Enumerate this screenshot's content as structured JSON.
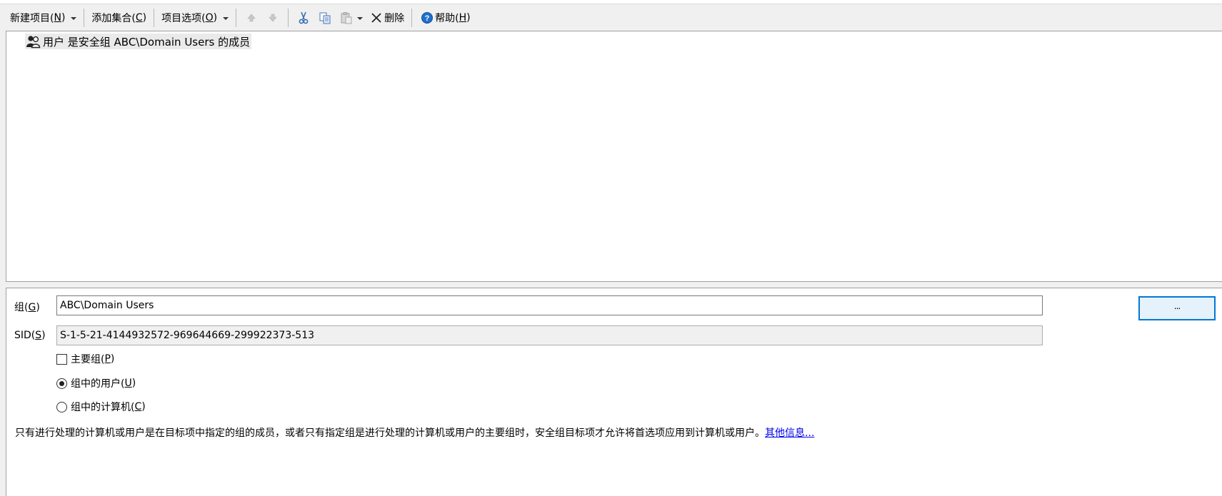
{
  "toolbar": {
    "new_item": {
      "label": "新建项目(",
      "key": "N",
      "end": ")"
    },
    "add_collection": {
      "label": "添加集合(",
      "key": "C",
      "end": ")"
    },
    "item_options": {
      "label": "项目选项(",
      "key": "O",
      "end": ")"
    },
    "delete_label": "删除",
    "help": {
      "label": "帮助(",
      "key": "H",
      "end": ")"
    }
  },
  "list": {
    "items": [
      {
        "label": "用户 是安全组 ABC\\Domain Users 的成员",
        "icon": "user-group-icon"
      }
    ]
  },
  "form": {
    "group": {
      "label": "组(",
      "key": "G",
      "end": ")",
      "value": "ABC\\Domain Users"
    },
    "browse_label": "...",
    "sid": {
      "label": "SID(",
      "key": "S",
      "end": ")",
      "value": "S-1-5-21-4144932572-969644669-299922373-513"
    },
    "primary_group": {
      "label": "主要组(",
      "key": "P",
      "end": ")",
      "checked": false
    },
    "users_in_group": {
      "label": "组中的用户(",
      "key": "U",
      "end": ")",
      "selected": true
    },
    "computers_in_group": {
      "label": "组中的计算机(",
      "key": "C",
      "end": ")",
      "selected": false
    }
  },
  "description": {
    "text": "只有进行处理的计算机或用户是在目标项中指定的组的成员，或者只有指定组是进行处理的计算机或用户的主要组时，安全组目标项才允许将首选项应用到计算机或用户。",
    "link": "其他信息..."
  },
  "colors": {
    "accent": "#0078d7",
    "link": "#0000ee",
    "help_icon": "#1e6fcf"
  }
}
